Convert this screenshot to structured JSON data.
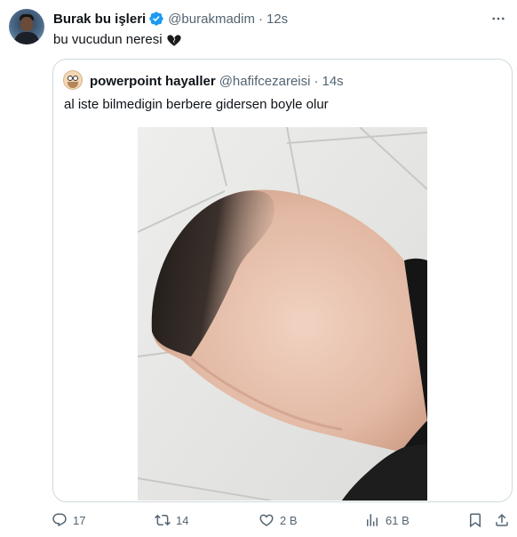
{
  "tweet": {
    "display_name": "Burak bu işleri",
    "handle": "@burakmadim",
    "separator": "·",
    "time": "12s",
    "text": "bu vucudun neresi",
    "emoji_icon": "black-heart-emoji",
    "more_icon": "more-horizontal-icon"
  },
  "quoted_tweet": {
    "display_name": "powerpoint hayaller",
    "handle": "@hafifcezareisi",
    "separator": "·",
    "time": "14s",
    "text": "al iste bilmedigin berbere gidersen boyle olur",
    "media": {
      "type": "photo",
      "subject": "close-up of a shaved head and neck against a white tiled wall"
    }
  },
  "actions": {
    "reply": {
      "icon": "reply-icon",
      "count": "17"
    },
    "retweet": {
      "icon": "retweet-icon",
      "count": "14"
    },
    "like": {
      "icon": "heart-icon",
      "count": "2 B"
    },
    "views": {
      "icon": "views-chart-icon",
      "count": "61 B"
    },
    "bookmark": {
      "icon": "bookmark-icon"
    },
    "share": {
      "icon": "share-icon"
    }
  },
  "colors": {
    "verified": "#1d9bf0",
    "secondary_text": "#536471",
    "border": "#cfd9de"
  }
}
